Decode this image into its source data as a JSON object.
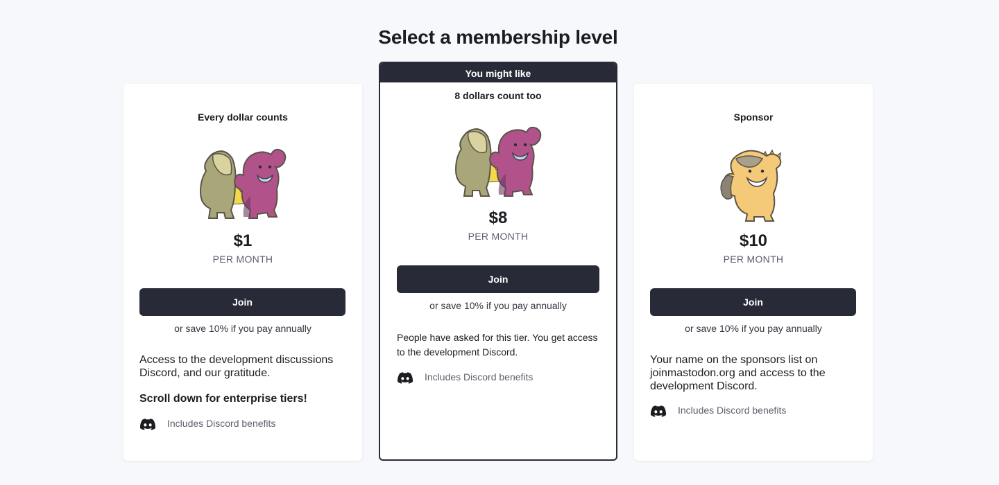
{
  "page": {
    "title": "Select a membership level"
  },
  "tiers": [
    {
      "name": "Every dollar counts",
      "price": "$1",
      "period": "PER MONTH",
      "join_label": "Join",
      "save_note": "or save 10% if you pay annually",
      "description": "Access to the development discussions Discord, and our gratitude.",
      "extra": "Scroll down for enterprise tiers!",
      "benefit": "Includes Discord benefits",
      "mascot_icon": "two-mastodons-high-five"
    },
    {
      "ribbon": "You might like",
      "name": "8 dollars count too",
      "price": "$8",
      "period": "PER MONTH",
      "join_label": "Join",
      "save_note": "or save 10% if you pay annually",
      "description": "People have asked for this tier. You get access to the development Discord.",
      "benefit": "Includes Discord benefits",
      "mascot_icon": "two-mastodons-high-five"
    },
    {
      "name": "Sponsor",
      "price": "$10",
      "period": "PER MONTH",
      "join_label": "Join",
      "save_note": "or save 10% if you pay annually",
      "description": "Your name on the sponsors list on joinmastodon.org and access to the development Discord.",
      "benefit": "Includes Discord benefits",
      "mascot_icon": "mastodon-with-crown"
    }
  ],
  "colors": {
    "background": "#f6f8fb",
    "card": "#ffffff",
    "button": "#282b37",
    "muted_text": "#5c5f6b"
  }
}
